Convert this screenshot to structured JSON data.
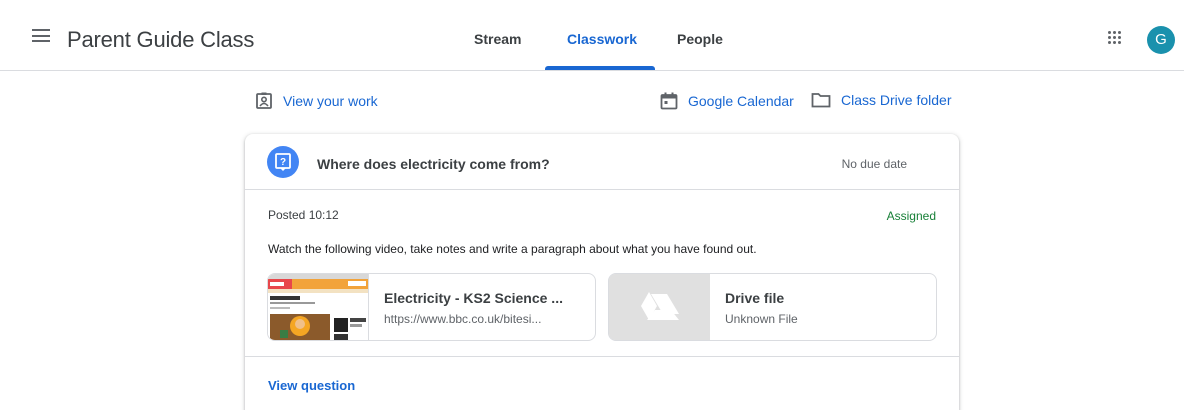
{
  "header": {
    "class_title": "Parent Guide Class",
    "avatar_letter": "G",
    "avatar_color": "#1a91ad",
    "tabs": [
      {
        "label": "Stream",
        "active": false
      },
      {
        "label": "Classwork",
        "active": true
      },
      {
        "label": "People",
        "active": false
      }
    ],
    "accent_color": "#1967d2"
  },
  "links": {
    "view_work": "View your work",
    "calendar": "Google Calendar",
    "drive_folder": "Class Drive folder"
  },
  "question": {
    "title": "Where does electricity come from?",
    "due": "No due date",
    "posted": "Posted 10:12",
    "status": "Assigned",
    "status_color": "#188038",
    "instructions": "Watch the following video, take notes and write a paragraph about what you have found out.",
    "attachments": [
      {
        "title": "Electricity - KS2 Science ...",
        "subtitle": "https://www.bbc.co.uk/bitesi...",
        "icon": "bbc-bitesize-thumbnail"
      },
      {
        "title": "Drive file",
        "subtitle": "Unknown File",
        "icon": "drive-icon"
      }
    ],
    "view_label": "View question"
  }
}
